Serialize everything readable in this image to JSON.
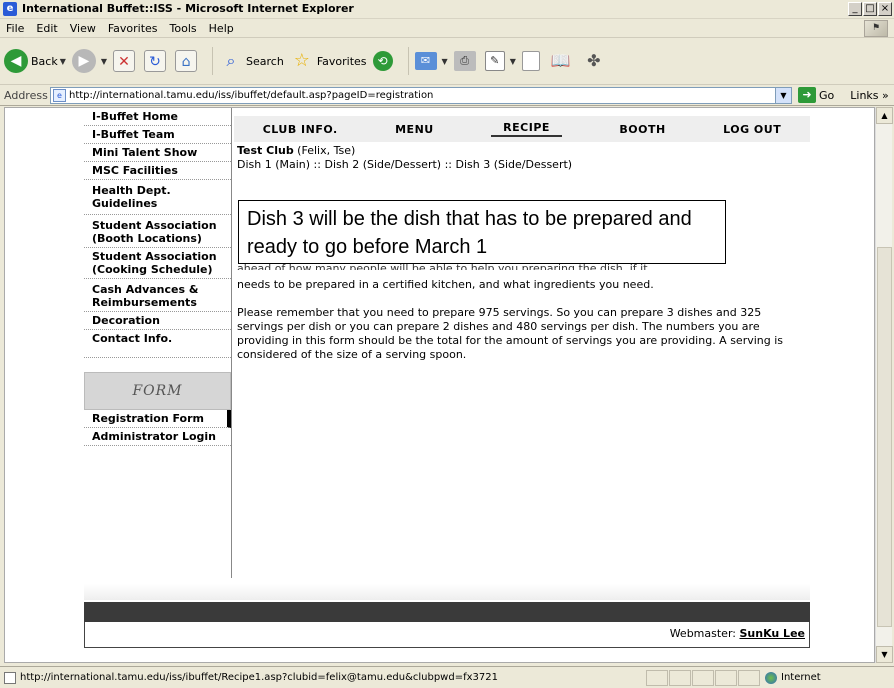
{
  "window": {
    "title": "International Buffet::ISS - Microsoft Internet Explorer",
    "controls": [
      "_",
      "□",
      "×"
    ]
  },
  "menu": [
    "File",
    "Edit",
    "View",
    "Favorites",
    "Tools",
    "Help"
  ],
  "toolbar": {
    "back": "Back",
    "search": "Search",
    "favorites": "Favorites"
  },
  "address": {
    "label": "Address",
    "url": "http://international.tamu.edu/iss/ibuffet/default.asp?pageID=registration",
    "go": "Go",
    "links": "Links »"
  },
  "sidebar": {
    "items": [
      "I-Buffet Home",
      "I-Buffet Team",
      "Mini Talent Show",
      "MSC Facilities",
      "Health Dept. Guidelines",
      "Student Association (Booth Locations)",
      "Student Association (Cooking Schedule)",
      "Cash Advances & Reimbursements",
      "Decoration",
      "Contact Info."
    ],
    "form_header": "FORM",
    "form_items": [
      "Registration Form",
      "Administrator Login"
    ]
  },
  "nav": [
    "CLUB INFO.",
    "MENU",
    "RECIPE",
    "BOOTH",
    "LOG OUT"
  ],
  "content": {
    "club_name": "Test Club",
    "club_contact": " (Felix, Tse)",
    "dishes": "Dish 1 (Main) :: Dish 2 (Side/Dessert) :: Dish 3 (Side/Dessert)",
    "callout": "Dish 3 will be the dish that has to be prepared and ready to go before March 1",
    "partial_line": "ahead of how many people will be able to help you preparing the dish, if it",
    "para1": "needs to be prepared in a certified kitchen, and what ingredients you need.",
    "para2": "Please remember that you need to prepare 975 servings. So you can prepare 3 dishes and 325 servings per dish or you can prepare 2 dishes and 480 servings per dish. The numbers you are providing in this form should be the total for the amount of servings you are providing. A serving is considered of the size of a serving spoon."
  },
  "footer": {
    "label": "Webmaster: ",
    "name": "SunKu Lee"
  },
  "status": {
    "text": "http://international.tamu.edu/iss/ibuffet/Recipe1.asp?clubid=felix@tamu.edu&clubpwd=fx3721",
    "zone": "Internet"
  }
}
